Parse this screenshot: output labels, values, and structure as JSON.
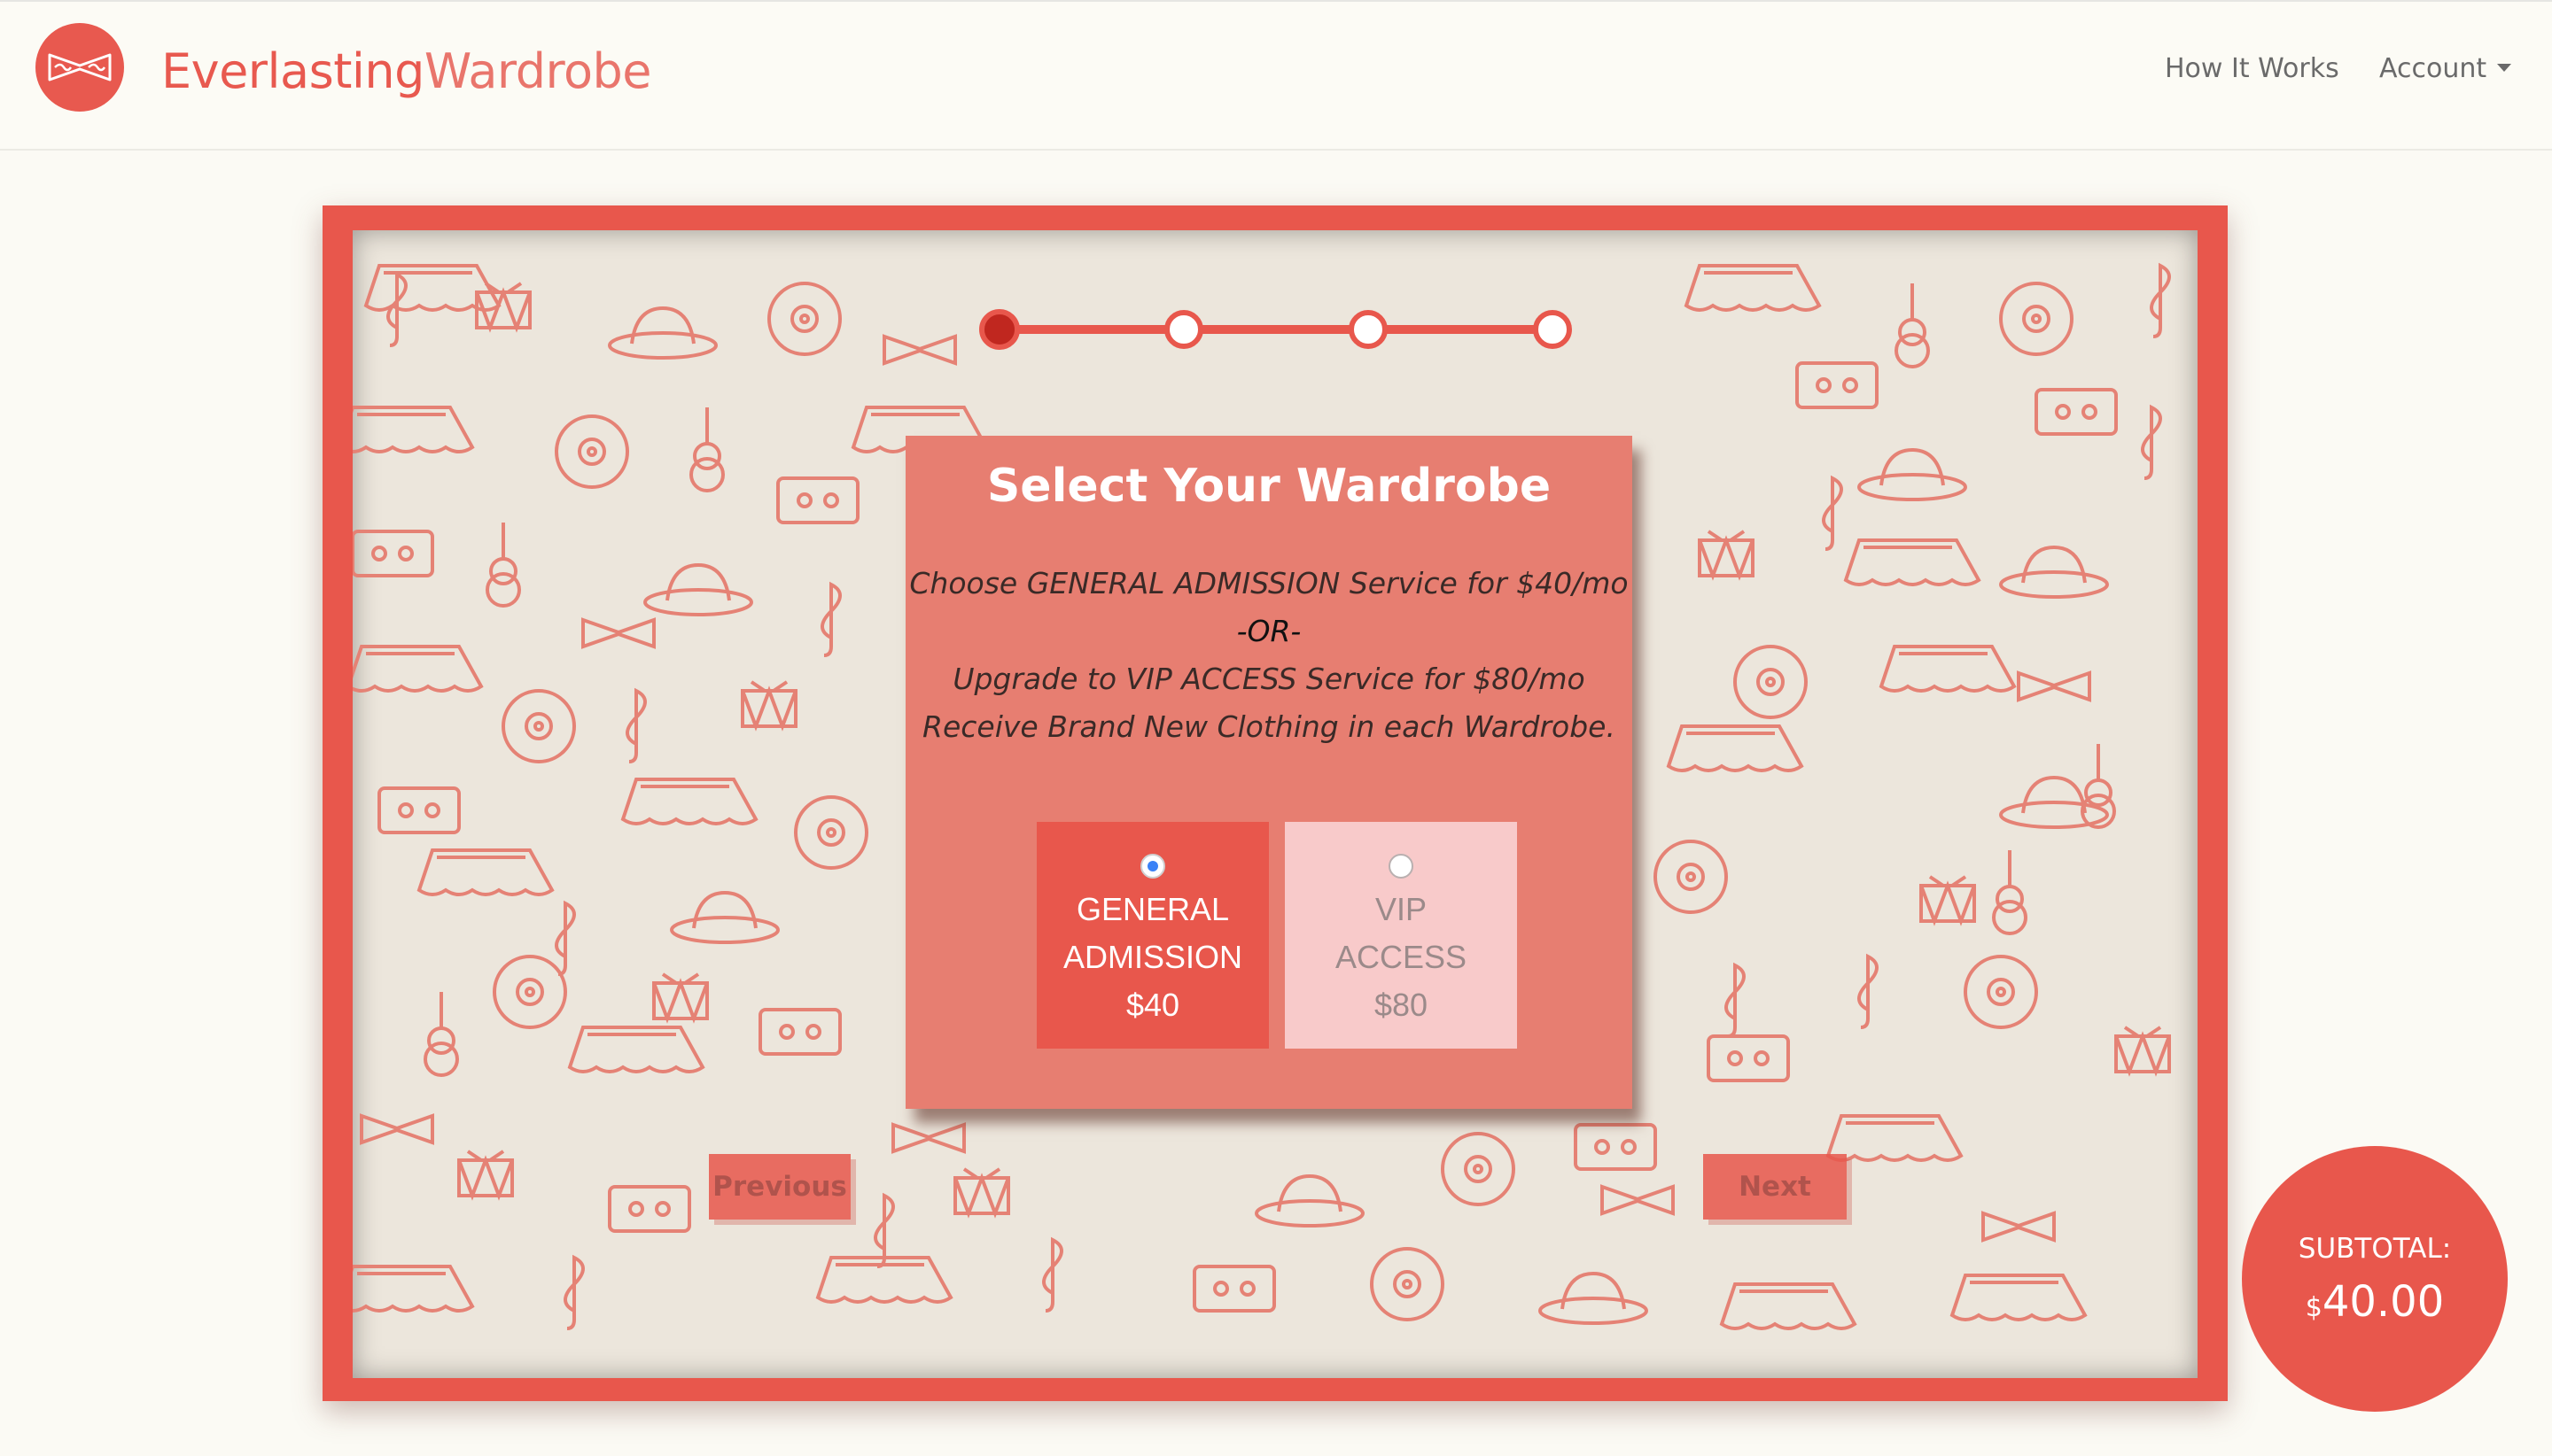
{
  "header": {
    "brand_part1": "Everlasting",
    "brand_part2": "Wardrobe",
    "nav": {
      "how_it_works": "How It Works",
      "account": "Account"
    }
  },
  "wizard": {
    "steps_total": 4,
    "current_step": 1
  },
  "card": {
    "title": "Select Your Wardrobe",
    "line1": "Choose GENERAL ADMISSION Service for $40/mo",
    "line2": "-OR-",
    "line3": "Upgrade to VIP ACCESS Service for $80/mo",
    "line4": "Receive Brand New Clothing in each Wardrobe.",
    "options": [
      {
        "line1": "GENERAL",
        "line2": "ADMISSION",
        "price": "$40",
        "selected": true
      },
      {
        "line1": "VIP",
        "line2": "ACCESS",
        "price": "$80",
        "selected": false
      }
    ]
  },
  "buttons": {
    "previous": "Previous",
    "next": "Next"
  },
  "subtotal": {
    "label": "SUBTOTAL:",
    "currency": "$",
    "amount": "40.00"
  },
  "colors": {
    "brand": "#e8594f",
    "card": "#e77e71",
    "vip_option": "#f8caca",
    "pattern_bg": "#ece6dc",
    "radio_selected": "#3b82f6"
  }
}
